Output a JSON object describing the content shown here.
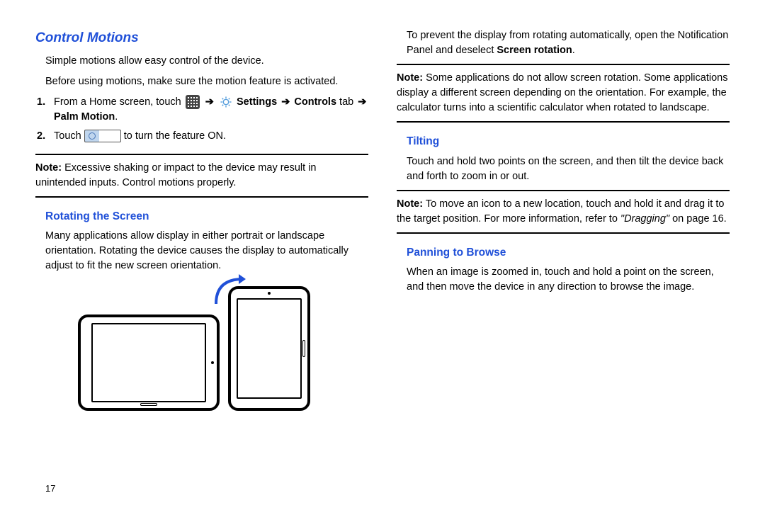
{
  "left": {
    "h2": "Control Motions",
    "p1": "Simple motions allow easy control of the device.",
    "p2": "Before using motions, make sure the motion feature is activated.",
    "step1_a": "From a Home screen, touch",
    "step1_arrow": "➔",
    "step1_settings": "Settings",
    "step1_arrow2": "➔",
    "step1_b": "Controls",
    "step1_tab": " tab ",
    "step1_arrow3": "➔",
    "step1_c": " Palm Motion",
    "step1_end": ".",
    "step2_a": "Touch",
    "step2_b": " to turn the feature ON.",
    "note1_prefix": "Note:",
    "note1": " Excessive shaking or impact to the device may result in unintended inputs. Control motions properly.",
    "h3_rotate": "Rotating the Screen",
    "rotate_p": "Many applications allow display in either portrait or landscape orientation. Rotating the device causes the display to automatically adjust to fit the new screen orientation.",
    "page_num": "17"
  },
  "right": {
    "p1a": "To prevent the display from rotating automatically, open the Notification Panel and deselect ",
    "p1b": "Screen rotation",
    "p1c": ".",
    "note1_prefix": "Note:",
    "note1": " Some applications do not allow screen rotation. Some applications display a different screen depending on the orientation. For example, the calculator turns into a scientific calculator when rotated to landscape.",
    "h3_tilt": "Tilting",
    "tilt_p": "Touch and hold two points on the screen, and then tilt the device back and forth to zoom in or out.",
    "note2_prefix": "Note:",
    "note2a": " To move an icon to a new location, touch and hold it and drag it to the target position. For more information, refer to ",
    "note2link": "\"Dragging\"",
    "note2b": " on page 16.",
    "h3_pan": "Panning to Browse",
    "pan_p": "When an image is zoomed in, touch and hold a point on the screen, and then move the device in any direction to browse the image."
  }
}
